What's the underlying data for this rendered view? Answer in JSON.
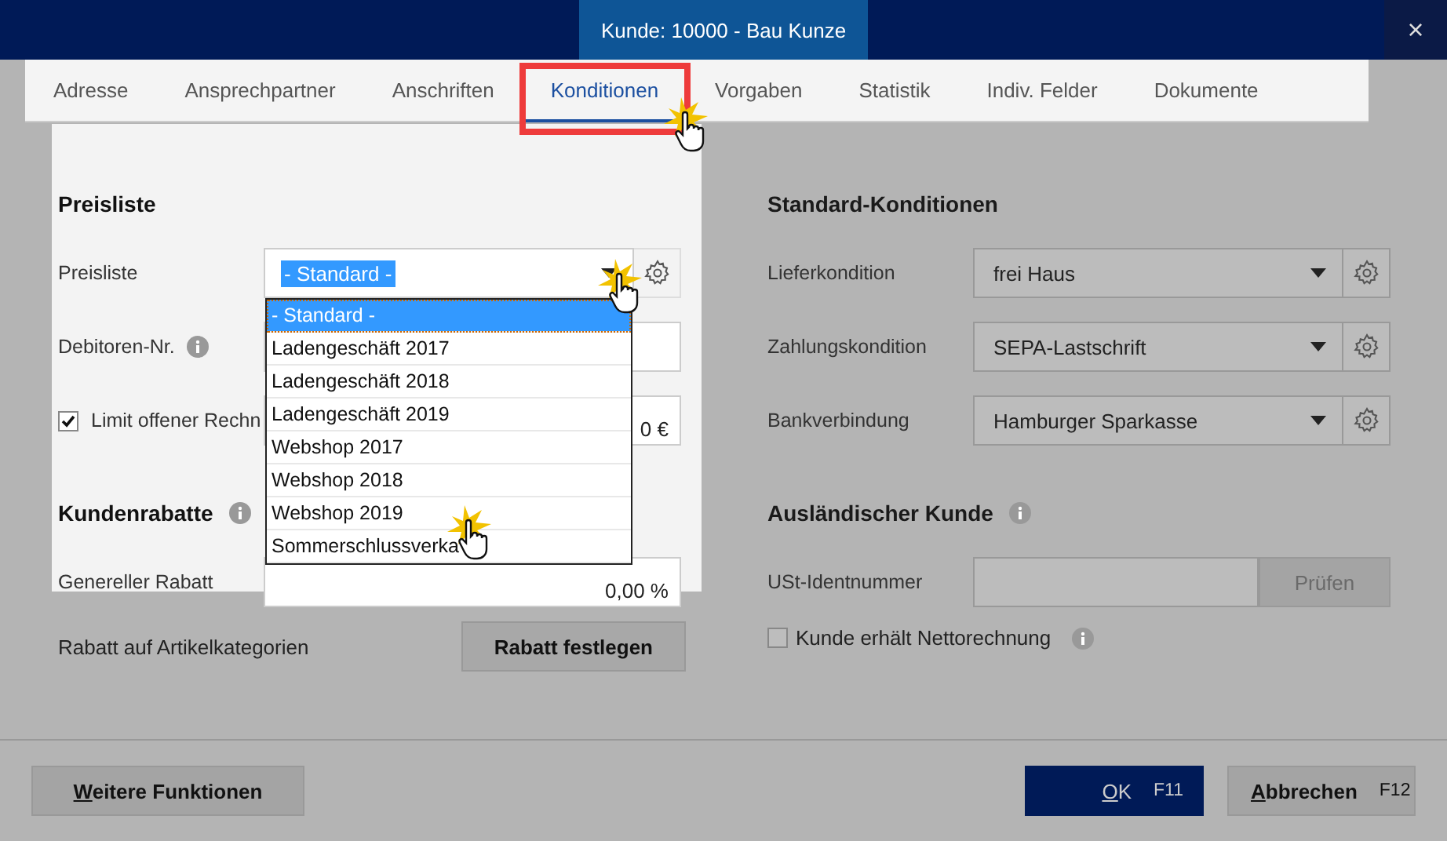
{
  "window": {
    "title": "Kunde: 10000 - Bau Kunze",
    "close": "×"
  },
  "tabs": [
    {
      "label": "Adresse",
      "selected": false
    },
    {
      "label": "Ansprechpartner",
      "selected": false
    },
    {
      "label": "Anschriften",
      "selected": false
    },
    {
      "label": "Konditionen",
      "selected": true,
      "highlighted": true
    },
    {
      "label": "Vorgaben",
      "selected": false
    },
    {
      "label": "Statistik",
      "selected": false
    },
    {
      "label": "Indiv. Felder",
      "selected": false
    },
    {
      "label": "Dokumente",
      "selected": false
    }
  ],
  "left": {
    "heading": "Preisliste",
    "rows": [
      {
        "kind": "select",
        "label": "Preisliste",
        "value": "- Standard -",
        "open": true
      },
      {
        "kind": "input",
        "label": "Debitoren-Nr.",
        "info": true
      },
      {
        "kind": "checkbox",
        "label": "Limit offener Rechn",
        "checked": true,
        "value": "0 €"
      }
    ],
    "heading2": "Kundenrabatte",
    "rows2": [
      {
        "kind": "input",
        "label": "Genereller Rabatt",
        "value": "0,00 %"
      }
    ],
    "dropdown": [
      {
        "label": "- Standard -",
        "selected": true
      },
      {
        "label": "Ladengeschäft 2017",
        "selected": false
      },
      {
        "label": "Ladengeschäft 2018",
        "selected": false
      },
      {
        "label": "Ladengeschäft 2019",
        "selected": false
      },
      {
        "label": "Webshop 2017",
        "selected": false
      },
      {
        "label": "Webshop 2018",
        "selected": false
      },
      {
        "label": "Webshop 2019",
        "selected": false
      },
      {
        "label": "Sommerschlussverka",
        "selected": false
      }
    ],
    "category_label": "Rabatt auf Artikelkategorien",
    "category_button": "Rabatt festlegen"
  },
  "right": {
    "heading": "Standard-Konditionen",
    "rows": [
      {
        "kind": "select",
        "label": "Lieferkondition",
        "value": "frei Haus"
      },
      {
        "kind": "select",
        "label": "Zahlungskondition",
        "value": "SEPA-Lastschrift"
      },
      {
        "kind": "select",
        "label": "Bankverbindung",
        "value": "Hamburger Sparkasse"
      }
    ],
    "heading2": "Ausländischer Kunde",
    "vat_label": "USt-Identnummer",
    "vat_button": "Prüfen",
    "vat_button_disabled": true,
    "netto": {
      "label": "Kunde erhält Nettorechnung",
      "checked": false
    }
  },
  "footer": {
    "more": {
      "label": "Weitere Funktionen",
      "underline_first": true
    },
    "ok": {
      "label": "OK",
      "key": "F11",
      "underline_first": true
    },
    "cancel": {
      "label": "Abbrechen",
      "key": "F12",
      "underline_first": true
    }
  }
}
